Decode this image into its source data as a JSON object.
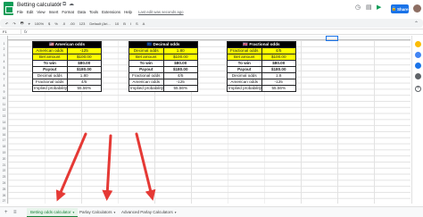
{
  "app": {
    "title": "Betting calculator",
    "menu": [
      "File",
      "Edit",
      "View",
      "Insert",
      "Format",
      "Data",
      "Tools",
      "Extensions",
      "Help"
    ],
    "last_edit": "Last edit was seconds ago",
    "share_label": "Share"
  },
  "toolbar": {
    "items": [
      "↶",
      "↷",
      "🖶",
      "⌖",
      "100%",
      "$",
      "%",
      ".0",
      ".00",
      "123",
      "Default (Ari...",
      "10",
      "B",
      "I",
      "S",
      "A"
    ]
  },
  "formula_bar": {
    "name_box": "F1",
    "fx": "fx",
    "value": ""
  },
  "rows": [
    "1",
    "2",
    "3",
    "4",
    "5",
    "6",
    "7",
    "8",
    "9",
    "10",
    "11",
    "12",
    "13",
    "14",
    "15",
    "16",
    "17",
    "18",
    "19",
    "20",
    "21",
    "22",
    "23",
    "24",
    "25",
    "26",
    "27"
  ],
  "tables": [
    {
      "header": "🇺🇸 American odds",
      "rows": [
        {
          "label": "American odds",
          "value": "-125",
          "style": "yellow"
        },
        {
          "label": "Bet amount",
          "value": "$100.00",
          "style": "yellow"
        },
        {
          "label": "To win",
          "value": "$80.00",
          "style": "bold"
        },
        {
          "label": "Payout",
          "value": "$180.00",
          "style": "bold"
        },
        {
          "label": "Decimal odds",
          "value": "1.80",
          "style": ""
        },
        {
          "label": "Fractional odds",
          "value": "4/5",
          "style": ""
        },
        {
          "label": "Implied probability",
          "value": "55.56%",
          "style": ""
        }
      ]
    },
    {
      "header": "🇪🇺 Decimal odds",
      "rows": [
        {
          "label": "Decimal odds",
          "value": "1.80",
          "style": "yellow"
        },
        {
          "label": "Bet amount",
          "value": "$100.00",
          "style": "yellow"
        },
        {
          "label": "To win",
          "value": "$80.00",
          "style": "bold"
        },
        {
          "label": "Payout",
          "value": "$180.00",
          "style": "bold"
        },
        {
          "label": "Fractional odds",
          "value": "4/5",
          "style": ""
        },
        {
          "label": "American odds",
          "value": "-125",
          "style": ""
        },
        {
          "label": "Implied probability",
          "value": "55.56%",
          "style": ""
        }
      ]
    },
    {
      "header": "🇬🇧 Fractional odds",
      "rows": [
        {
          "label": "Fractional odds",
          "value": "4/5",
          "style": "yellow"
        },
        {
          "label": "Bet amount",
          "value": "$100.00",
          "style": "yellow"
        },
        {
          "label": "To win",
          "value": "$80.00",
          "style": "bold"
        },
        {
          "label": "Payout",
          "value": "$180.00",
          "style": "bold"
        },
        {
          "label": "Decimal odds",
          "value": "1.8",
          "style": ""
        },
        {
          "label": "American odds",
          "value": "-125",
          "style": ""
        },
        {
          "label": "Implied probability",
          "value": "55.56%",
          "style": ""
        }
      ]
    }
  ],
  "sheet_tabs": [
    {
      "label": "Betting odds calculator",
      "active": true
    },
    {
      "label": "Parlay Calculators",
      "active": false
    },
    {
      "label": "Advanced Parlay Calculators",
      "active": false
    }
  ],
  "colors": {
    "sheets_green": "#0f9d58",
    "highlight_yellow": "#ffff00",
    "arrow_red": "#e53935",
    "share_blue": "#1a73e8"
  },
  "icons": {
    "star": "star-icon",
    "move": "move-to-folder-icon",
    "cloud": "cloud-saved-icon",
    "add_sheet": "add-sheet-icon",
    "all_sheets": "all-sheets-icon",
    "history": "history-icon",
    "comment": "comment-icon",
    "meet": "meet-icon"
  }
}
